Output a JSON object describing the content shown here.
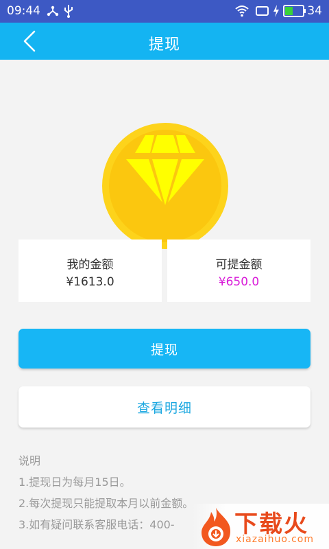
{
  "status_bar": {
    "time": "09:44",
    "battery": "34"
  },
  "header": {
    "title": "提现"
  },
  "balance_cards": [
    {
      "label": "我的金额",
      "value": "¥1613.0"
    },
    {
      "label": "可提金额",
      "value": "¥650.0"
    }
  ],
  "buttons": {
    "withdraw": "提现",
    "details": "查看明细"
  },
  "notes": {
    "title": "说明",
    "items": [
      "1.提现日为每月15日。",
      "2.每次提现只能提取本月以前金额。",
      "3.如有疑问联系客服电话：400-"
    ]
  },
  "watermark": {
    "brand": "下载火",
    "domain": "xiazaihuo.com"
  },
  "colors": {
    "status_bar": "#3d59c4",
    "header": "#14b4f2",
    "primary_button": "#17b6f5",
    "coin_outer": "#fdd31b",
    "diamond": "#ffff00",
    "withdrawable_value": "#d81bd8"
  }
}
